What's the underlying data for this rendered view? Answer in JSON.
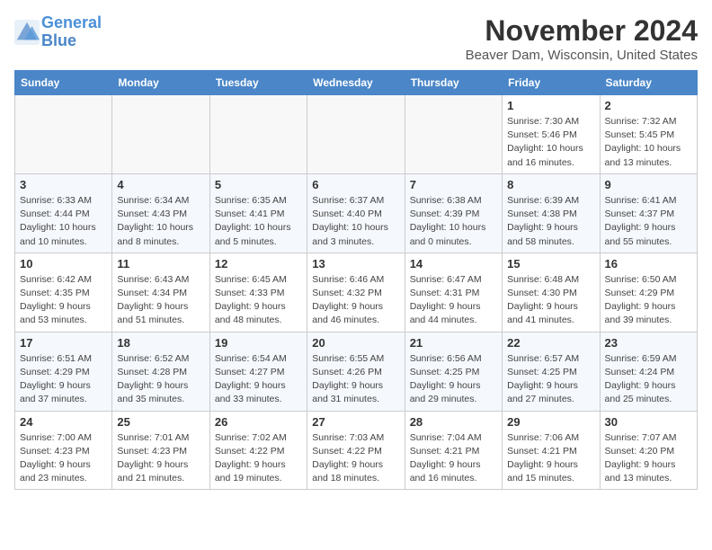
{
  "header": {
    "logo_line1": "General",
    "logo_line2": "Blue",
    "month": "November 2024",
    "location": "Beaver Dam, Wisconsin, United States"
  },
  "days_of_week": [
    "Sunday",
    "Monday",
    "Tuesday",
    "Wednesday",
    "Thursday",
    "Friday",
    "Saturday"
  ],
  "weeks": [
    [
      {
        "day": "",
        "info": ""
      },
      {
        "day": "",
        "info": ""
      },
      {
        "day": "",
        "info": ""
      },
      {
        "day": "",
        "info": ""
      },
      {
        "day": "",
        "info": ""
      },
      {
        "day": "1",
        "info": "Sunrise: 7:30 AM\nSunset: 5:46 PM\nDaylight: 10 hours and 16 minutes."
      },
      {
        "day": "2",
        "info": "Sunrise: 7:32 AM\nSunset: 5:45 PM\nDaylight: 10 hours and 13 minutes."
      }
    ],
    [
      {
        "day": "3",
        "info": "Sunrise: 6:33 AM\nSunset: 4:44 PM\nDaylight: 10 hours and 10 minutes."
      },
      {
        "day": "4",
        "info": "Sunrise: 6:34 AM\nSunset: 4:43 PM\nDaylight: 10 hours and 8 minutes."
      },
      {
        "day": "5",
        "info": "Sunrise: 6:35 AM\nSunset: 4:41 PM\nDaylight: 10 hours and 5 minutes."
      },
      {
        "day": "6",
        "info": "Sunrise: 6:37 AM\nSunset: 4:40 PM\nDaylight: 10 hours and 3 minutes."
      },
      {
        "day": "7",
        "info": "Sunrise: 6:38 AM\nSunset: 4:39 PM\nDaylight: 10 hours and 0 minutes."
      },
      {
        "day": "8",
        "info": "Sunrise: 6:39 AM\nSunset: 4:38 PM\nDaylight: 9 hours and 58 minutes."
      },
      {
        "day": "9",
        "info": "Sunrise: 6:41 AM\nSunset: 4:37 PM\nDaylight: 9 hours and 55 minutes."
      }
    ],
    [
      {
        "day": "10",
        "info": "Sunrise: 6:42 AM\nSunset: 4:35 PM\nDaylight: 9 hours and 53 minutes."
      },
      {
        "day": "11",
        "info": "Sunrise: 6:43 AM\nSunset: 4:34 PM\nDaylight: 9 hours and 51 minutes."
      },
      {
        "day": "12",
        "info": "Sunrise: 6:45 AM\nSunset: 4:33 PM\nDaylight: 9 hours and 48 minutes."
      },
      {
        "day": "13",
        "info": "Sunrise: 6:46 AM\nSunset: 4:32 PM\nDaylight: 9 hours and 46 minutes."
      },
      {
        "day": "14",
        "info": "Sunrise: 6:47 AM\nSunset: 4:31 PM\nDaylight: 9 hours and 44 minutes."
      },
      {
        "day": "15",
        "info": "Sunrise: 6:48 AM\nSunset: 4:30 PM\nDaylight: 9 hours and 41 minutes."
      },
      {
        "day": "16",
        "info": "Sunrise: 6:50 AM\nSunset: 4:29 PM\nDaylight: 9 hours and 39 minutes."
      }
    ],
    [
      {
        "day": "17",
        "info": "Sunrise: 6:51 AM\nSunset: 4:29 PM\nDaylight: 9 hours and 37 minutes."
      },
      {
        "day": "18",
        "info": "Sunrise: 6:52 AM\nSunset: 4:28 PM\nDaylight: 9 hours and 35 minutes."
      },
      {
        "day": "19",
        "info": "Sunrise: 6:54 AM\nSunset: 4:27 PM\nDaylight: 9 hours and 33 minutes."
      },
      {
        "day": "20",
        "info": "Sunrise: 6:55 AM\nSunset: 4:26 PM\nDaylight: 9 hours and 31 minutes."
      },
      {
        "day": "21",
        "info": "Sunrise: 6:56 AM\nSunset: 4:25 PM\nDaylight: 9 hours and 29 minutes."
      },
      {
        "day": "22",
        "info": "Sunrise: 6:57 AM\nSunset: 4:25 PM\nDaylight: 9 hours and 27 minutes."
      },
      {
        "day": "23",
        "info": "Sunrise: 6:59 AM\nSunset: 4:24 PM\nDaylight: 9 hours and 25 minutes."
      }
    ],
    [
      {
        "day": "24",
        "info": "Sunrise: 7:00 AM\nSunset: 4:23 PM\nDaylight: 9 hours and 23 minutes."
      },
      {
        "day": "25",
        "info": "Sunrise: 7:01 AM\nSunset: 4:23 PM\nDaylight: 9 hours and 21 minutes."
      },
      {
        "day": "26",
        "info": "Sunrise: 7:02 AM\nSunset: 4:22 PM\nDaylight: 9 hours and 19 minutes."
      },
      {
        "day": "27",
        "info": "Sunrise: 7:03 AM\nSunset: 4:22 PM\nDaylight: 9 hours and 18 minutes."
      },
      {
        "day": "28",
        "info": "Sunrise: 7:04 AM\nSunset: 4:21 PM\nDaylight: 9 hours and 16 minutes."
      },
      {
        "day": "29",
        "info": "Sunrise: 7:06 AM\nSunset: 4:21 PM\nDaylight: 9 hours and 15 minutes."
      },
      {
        "day": "30",
        "info": "Sunrise: 7:07 AM\nSunset: 4:20 PM\nDaylight: 9 hours and 13 minutes."
      }
    ]
  ]
}
